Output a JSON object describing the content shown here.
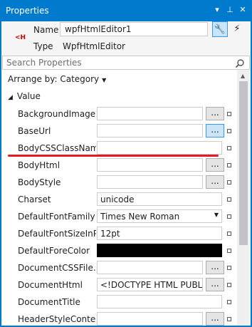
{
  "window": {
    "title": "Properties",
    "controls": [
      "▾",
      "⊥",
      "✕"
    ]
  },
  "object": {
    "icon_text": "<H",
    "name_label": "Name",
    "name_value": "wpfHtmlEditor1",
    "type_label": "Type",
    "type_value": "WpfHtmlEditor"
  },
  "search": {
    "placeholder": "Search Properties"
  },
  "grid": {
    "arrange_label": "Arrange by: Category",
    "category": "Value",
    "rows": [
      {
        "name": "BackgroundImage...",
        "value": "",
        "editor": "..."
      },
      {
        "name": "BaseUrl",
        "value": "",
        "editor": "..."
      },
      {
        "name": "BodyCSSClassName",
        "value": ""
      },
      {
        "name": "BodyHtml",
        "value": "",
        "editor": "..."
      },
      {
        "name": "BodyStyle",
        "value": "",
        "editor": "..."
      },
      {
        "name": "Charset",
        "value": "unicode"
      },
      {
        "name": "DefaultFontFamily",
        "value": "Times New Roman",
        "dropdown": true
      },
      {
        "name": "DefaultFontSizeInPt",
        "value": "12pt"
      },
      {
        "name": "DefaultForeColor",
        "value": "",
        "swatch": "#000000"
      },
      {
        "name": "DocumentCSSFile...",
        "value": "",
        "editor": "..."
      },
      {
        "name": "DocumentHtml",
        "value": "<!DOCTYPE HTML PUBLIC",
        "editor": "..."
      },
      {
        "name": "DocumentTitle",
        "value": ""
      },
      {
        "name": "HeaderStyleContent",
        "value": "",
        "editor": "..."
      }
    ]
  },
  "colors": {
    "accent": "#007acc",
    "highlight_line": "#e31c24",
    "focus_border": "#3399ff"
  }
}
